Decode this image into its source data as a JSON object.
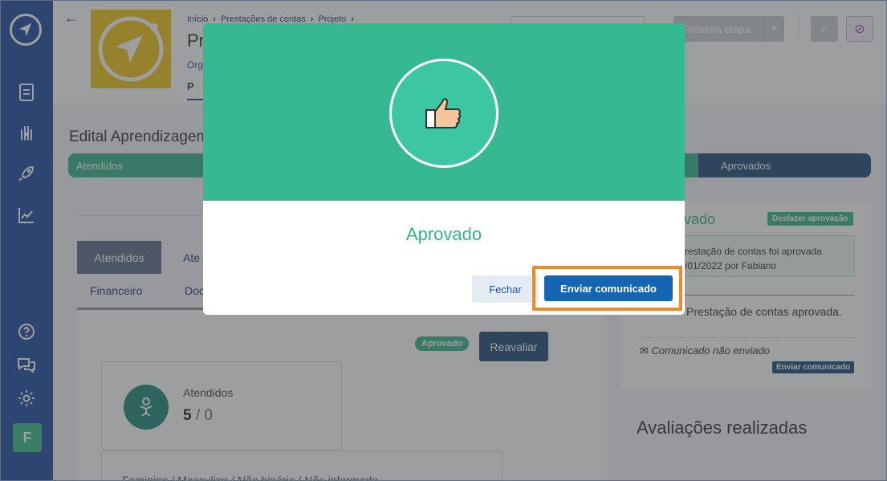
{
  "header": {
    "breadcrumb": [
      "Início",
      "Prestações de contas",
      "Projeto"
    ],
    "title_fragment": "Pr",
    "org_fragment": "Org",
    "tab_fragment": "P",
    "next_step_label": "Próxima etapa"
  },
  "edital": {
    "title": "Edital Aprendizagem",
    "steps": [
      "Atendidos",
      "Aprovados"
    ]
  },
  "tabs": {
    "row1": [
      "Atendidos",
      "Ate"
    ],
    "row2": [
      "Financeiro",
      "Doc"
    ]
  },
  "panel": {
    "status_badge": "Aprovado",
    "reevaluate_label": "Reavaliar",
    "attended_label": "Atendidos",
    "attended_value": "5",
    "attended_total": "0",
    "gender_text": "Feminino / Masculino / Não binário / Não informado"
  },
  "right_card": {
    "title": "ovado",
    "undo_label": "Desfazer aprovação",
    "info_line1": "restação de contas foi aprovada",
    "info_line2": "/01/2022 por Fabiano",
    "status_text": "Prestação de contas aprovada.",
    "communication_text": "Comunicado não enviado",
    "send_label": "Enviar comunicado"
  },
  "evaluations_title": "Avaliações realizadas",
  "modal": {
    "title": "Aprovado",
    "close_label": "Fechar",
    "send_label": "Enviar comunicado"
  },
  "sidebar": {
    "avatar_letter": "F",
    "icons": [
      "document-icon",
      "hand-heart-icon",
      "rocket-icon",
      "chart-icon",
      "help-icon",
      "chat-icon",
      "gear-icon"
    ]
  },
  "colors": {
    "sidebar": "#1f4fa0",
    "success": "#36b48c",
    "primary": "#1565b5",
    "highlight": "#f08a24"
  }
}
